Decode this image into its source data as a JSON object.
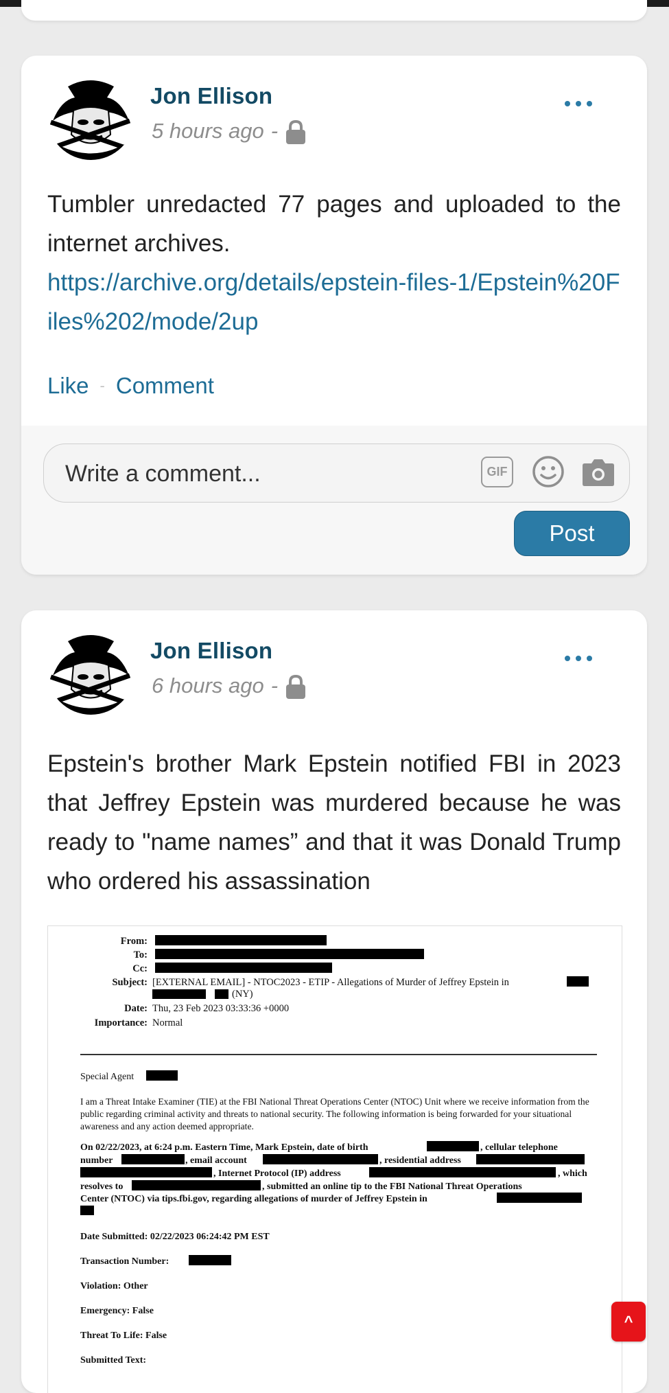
{
  "feed": {
    "posts": [
      {
        "author": "Jon Ellison",
        "time": "5 hours ago",
        "separator": "-",
        "text": "Tumbler unredacted 77 pages and uploaded to the internet archives.",
        "link": "https://archive.org/details/epstein-files-1/Epstein%20Files%202/mode/2up",
        "actions": {
          "like": "Like",
          "sep": "-",
          "comment": "Comment"
        },
        "comment_box": {
          "placeholder": "Write a comment...",
          "gif_label": "GIF",
          "post_button": "Post"
        }
      },
      {
        "author": "Jon Ellison",
        "time": "6 hours ago",
        "separator": "-",
        "text": "Epstein's brother Mark Epstein notified FBI in 2023 that Jeffrey Epstein was murdered because he was ready to \"name names” and that it was Donald Trump who ordered his assassination",
        "document": {
          "from_label": "From:",
          "to_label": "To:",
          "cc_label": "Cc:",
          "subject_label": "Subject:",
          "subject_value": "[EXTERNAL EMAIL] - NTOC2023 - ETIP - Allegations of Murder of Jeffrey Epstein in",
          "subject_cont": "(NY)",
          "date_label": "Date:",
          "date_value": "Thu, 23 Feb 2023 03:33:36 +0000",
          "importance_label": "Importance:",
          "importance_value": "Normal",
          "greeting": "Special Agent",
          "para1": "I am a Threat Intake Examiner (TIE) at the FBI National Threat Operations Center (NTOC) Unit where we receive information from the public regarding criminal activity and threats to national security. The following information is being forwarded for your situational awareness and any action deemed appropriate.",
          "para2_l1a": "On 02/22/2023, at 6:24 p.m. Eastern Time, Mark Epstein, date of birth",
          "para2_l1b": ", cellular telephone",
          "para2_l2a": "number",
          "para2_l2b": ", email account",
          "para2_l2c": ", residential address",
          "para2_l3a": ", Internet Protocol (IP) address",
          "para2_l3b": ", which",
          "para2_l4a": "resolves to",
          "para2_l4b": ", submitted an online tip to the FBI National Threat Operations",
          "para2_l5": "Center (NTOC) via tips.fbi.gov, regarding allegations of murder of Jeffrey Epstein in",
          "date_submitted": "Date Submitted: 02/22/2023 06:24:42 PM EST",
          "transaction_label": "Transaction Number:",
          "violation": "Violation: Other",
          "emergency": "Emergency: False",
          "threat": "Threat To Life: False",
          "submitted_text": "Submitted Text:"
        }
      }
    ]
  },
  "scroll_top": {
    "label": "^"
  },
  "colors": {
    "accent": "#2b7ba6",
    "author": "#134a64",
    "link": "#1d6c95",
    "scroll_top": "#e6141a"
  }
}
